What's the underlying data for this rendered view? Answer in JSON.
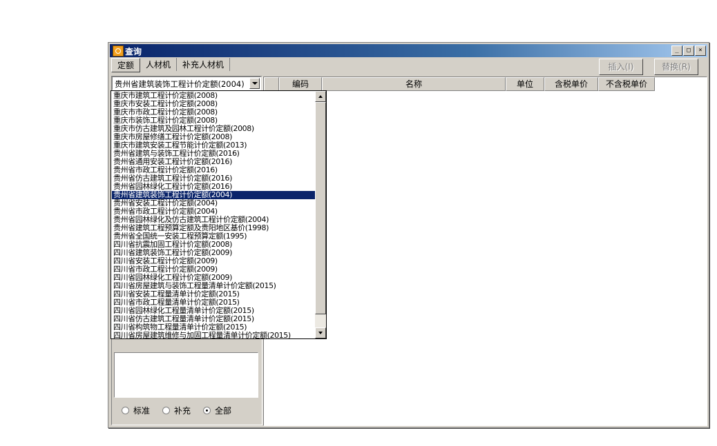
{
  "window": {
    "title": "查询",
    "controls": [
      "_",
      "□",
      "×"
    ]
  },
  "tabs": [
    {
      "label": "定额",
      "active": true
    },
    {
      "label": "人材机",
      "active": false
    },
    {
      "label": "补充人材机",
      "active": false
    }
  ],
  "buttons": {
    "insert": "插入(I)",
    "replace": "替换(R)"
  },
  "combo": {
    "selected": "贵州省建筑装饰工程计价定额(2004)"
  },
  "dropdown_items": [
    "重庆市建筑工程计价定额(2008)",
    "重庆市安装工程计价定额(2008)",
    "重庆市市政工程计价定额(2008)",
    "重庆市装饰工程计价定额(2008)",
    "重庆市仿古建筑及园林工程计价定额(2008)",
    "重庆市房屋修缮工程计价定额(2008)",
    "重庆市建筑安装工程节能计价定额(2013)",
    "贵州省建筑与装饰工程计价定额(2016)",
    "贵州省通用安装工程计价定额(2016)",
    "贵州省市政工程计价定额(2016)",
    "贵州省仿古建筑工程计价定额(2016)",
    "贵州省园林绿化工程计价定额(2016)",
    "贵州省建筑装饰工程计价定额(2004)",
    "贵州省安装工程计价定额(2004)",
    "贵州省市政工程计价定额(2004)",
    "贵州省园林绿化及仿古建筑工程计价定额(2004)",
    "贵州省建筑工程预算定额及贵阳地区基价(1998)",
    "贵州省全国统一安装工程预算定额(1995)",
    "四川省抗震加固工程计价定额(2008)",
    "四川省建筑装饰工程计价定额(2009)",
    "四川省安装工程计价定额(2009)",
    "四川省市政工程计价定额(2009)",
    "四川省园林绿化工程计价定额(2009)",
    "四川省房屋建筑与装饰工程量清单计价定额(2015)",
    "四川省安装工程量清单计价定额(2015)",
    "四川省市政工程量清单计价定额(2015)",
    "四川省园林绿化工程量清单计价定额(2015)",
    "四川省仿古建筑工程量清单计价定额(2015)",
    "四川省构筑物工程量清单计价定额(2015)",
    "四川省房屋建筑维修与加固工程量清单计价定额(2015)"
  ],
  "selected_index": 12,
  "radios": [
    {
      "label": "标准",
      "checked": false
    },
    {
      "label": "补充",
      "checked": false
    },
    {
      "label": "全部",
      "checked": true
    }
  ],
  "grid": {
    "columns": [
      "",
      "编码",
      "名称",
      "单位",
      "含税单价",
      "不含税单价"
    ]
  }
}
